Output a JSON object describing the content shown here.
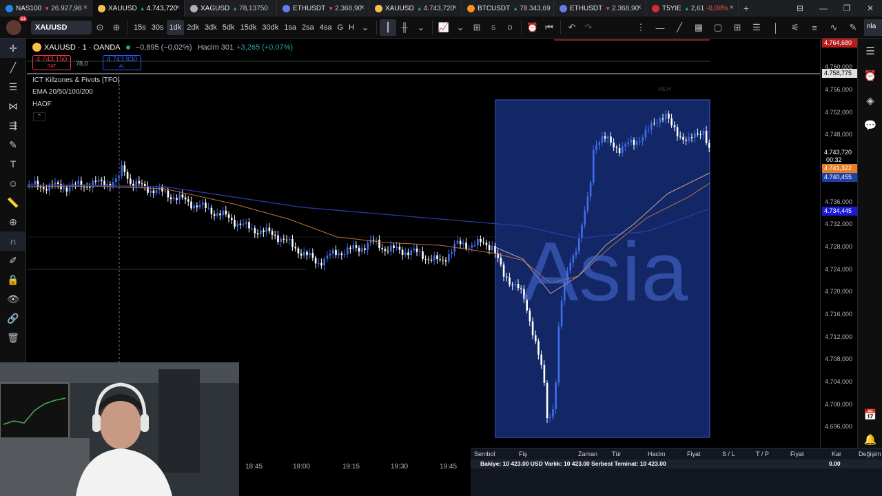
{
  "tabs": [
    {
      "name": "NAS100",
      "dir": "down",
      "price": "26.927,98",
      "icon_color": "#1e88e5",
      "active": false
    },
    {
      "name": "XAUUSD",
      "dir": "up",
      "price": "4.743,720",
      "icon_color": "#f5c04a",
      "active": true
    },
    {
      "name": "XAGUSD",
      "dir": "up",
      "price": "78,13750",
      "icon_color": "#b0b0b0",
      "active": false
    },
    {
      "name": "ETHUSDT",
      "dir": "down",
      "price": "2.368,90",
      "icon_color": "#627eea",
      "active": false
    },
    {
      "name": "XAUUSD",
      "dir": "up",
      "price": "4.743,720",
      "icon_color": "#f5c04a",
      "active": false
    },
    {
      "name": "BTCUSDT",
      "dir": "up",
      "price": "78.343,69",
      "icon_color": "#f7931a",
      "active": false
    },
    {
      "name": "ETHUSDT",
      "dir": "down",
      "price": "2.368,90",
      "icon_color": "#627eea",
      "active": false
    },
    {
      "name": "T5YIE",
      "dir": "up",
      "price": "2,61",
      "change": "-0,08%",
      "icon_color": "#d32f2f",
      "active": false
    }
  ],
  "new_tab": "+",
  "window_controls": [
    "⊟",
    "—",
    "❐",
    "✕"
  ],
  "toolbar": {
    "notification_count": "11",
    "symbol": "XAUUSD",
    "timeframes": [
      {
        "label": "15s",
        "active": false
      },
      {
        "label": "30s",
        "active": false
      },
      {
        "label": "1dk",
        "active": true
      },
      {
        "label": "2dk",
        "active": false
      },
      {
        "label": "3dk",
        "active": false
      },
      {
        "label": "5dk",
        "active": false
      },
      {
        "label": "15dk",
        "active": false
      },
      {
        "label": "30dk",
        "active": false
      },
      {
        "label": "1sa",
        "active": false
      },
      {
        "label": "2sa",
        "active": false
      },
      {
        "label": "4sa",
        "active": false
      },
      {
        "label": "G",
        "active": false
      },
      {
        "label": "H",
        "active": false
      }
    ],
    "s_label": "S",
    "o_label": "O",
    "publish_label": "nla"
  },
  "legend": {
    "title": "XAUUSD · 1 · OANDA",
    "change": "−0,895 (−0,02%)",
    "volume_label": "Hacim",
    "volume": "301",
    "volume_change": "+3,265 (+0,07%)",
    "sell_price": "4.743,150",
    "sell_label": "SAT",
    "spread": "78,0",
    "buy_price": "4.743,930",
    "buy_label": "AL",
    "indicators": [
      "ICT Killzones & Pivots [TFO]",
      "EMA 20/50/100/200",
      "HAOF"
    ],
    "collapse_symbol": "⌃"
  },
  "session": {
    "word": "Asia",
    "small_label": "AS.H"
  },
  "colors": {
    "up": "#26a69a",
    "down": "#ef5350",
    "candle_up": "#3f6fe8",
    "candle_down": "#ffffff",
    "session_fill": "#1f3fa6",
    "ema_orange": "#c0703a",
    "ema_blue": "#2a3ca8",
    "ema_light": "#c9a897"
  },
  "price_scale": {
    "ticks": [
      "4.764,680",
      "4.760,000",
      "4.758,775",
      "4.756,000",
      "4.752,000",
      "4.748,000",
      "4.743,720",
      "4.741,322",
      "4.740,455",
      "4.736,000",
      "4.734,445",
      "4.732,000",
      "4.728,000",
      "4.724,000",
      "4.720,000",
      "4.716,000",
      "4.712,000",
      "4.708,000",
      "4.704,000",
      "4.700,000",
      "4.696,000"
    ],
    "current_price": "4.743,720",
    "countdown": "00:32",
    "ema_orange_price": "4.741,322",
    "ema_blue_price": "4.740,455",
    "ema_blue2_price": "4.734,445",
    "red_line_price": "4.764,680",
    "white_line_price": "4.758,775"
  },
  "time_axis": [
    "18:45",
    "19:00",
    "19:15",
    "19:30",
    "19:45"
  ],
  "trading_panel": {
    "headers": [
      "Sembol",
      "Fiş",
      "Zaman",
      "Tür",
      "Hacim",
      "Fiyat",
      "S / L",
      "T / P",
      "Fiyat",
      "Kar",
      "Değişim"
    ],
    "account_summary": "Bakiye: 10 423.00 USD  Varlık: 10 423.00  Serbest Teminat: 10 423.00",
    "profit": "0.00"
  }
}
